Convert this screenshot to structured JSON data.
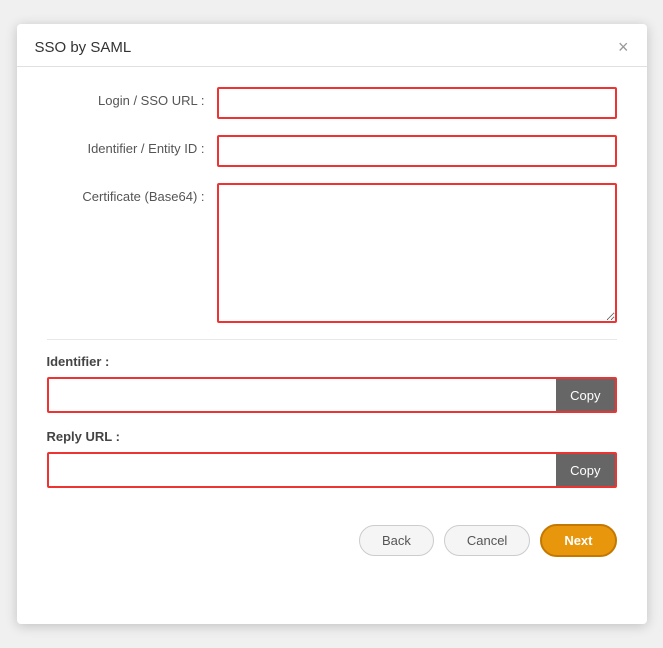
{
  "modal": {
    "title": "SSO by SAML",
    "close_icon": "×"
  },
  "form": {
    "login_sso_url_label": "Login / SSO URL :",
    "login_sso_url_value": "",
    "identifier_entity_id_label": "Identifier / Entity ID :",
    "identifier_entity_id_value": "",
    "certificate_label": "Certificate (Base64) :",
    "certificate_value": ""
  },
  "identifier_section": {
    "label": "Identifier :",
    "value": "",
    "copy_button": "Copy"
  },
  "reply_url_section": {
    "label": "Reply URL :",
    "value": "",
    "copy_button": "Copy"
  },
  "footer": {
    "back_button": "Back",
    "cancel_button": "Cancel",
    "next_button": "Next"
  }
}
